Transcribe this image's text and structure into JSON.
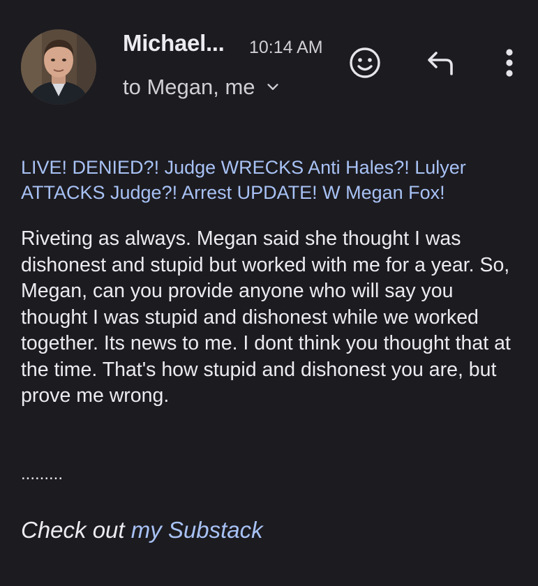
{
  "header": {
    "sender_name": "Michael...",
    "time": "10:14 AM",
    "recipients": "to Megan, me"
  },
  "icons": {
    "avatar": "sender-avatar-photo",
    "emoji": "emoji-reaction-icon",
    "reply": "reply-icon",
    "more": "more-vertical-icon",
    "expand": "chevron-down-icon"
  },
  "message": {
    "subject_link": "LIVE! DENIED?! Judge WRECKS Anti Hales?! Lulyer ATTACKS Judge?! Arrest UPDATE! W Megan Fox!",
    "body": "Riveting as always. Megan said she thought I was dishonest and stupid but worked with me for a year. So, Megan, can you provide anyone who will say you thought I was stupid and dishonest while we worked together. Its news to me. I dont think you thought that at the time. That's how stupid and dishonest you are, but prove me wrong.",
    "separator": ".........",
    "signoff_prefix": "Check out ",
    "signoff_link": "my Substack"
  },
  "colors": {
    "background": "#1c1b20",
    "text": "#ececf0",
    "link": "#a8c2f5",
    "secondary_text": "#cfcfd4"
  }
}
